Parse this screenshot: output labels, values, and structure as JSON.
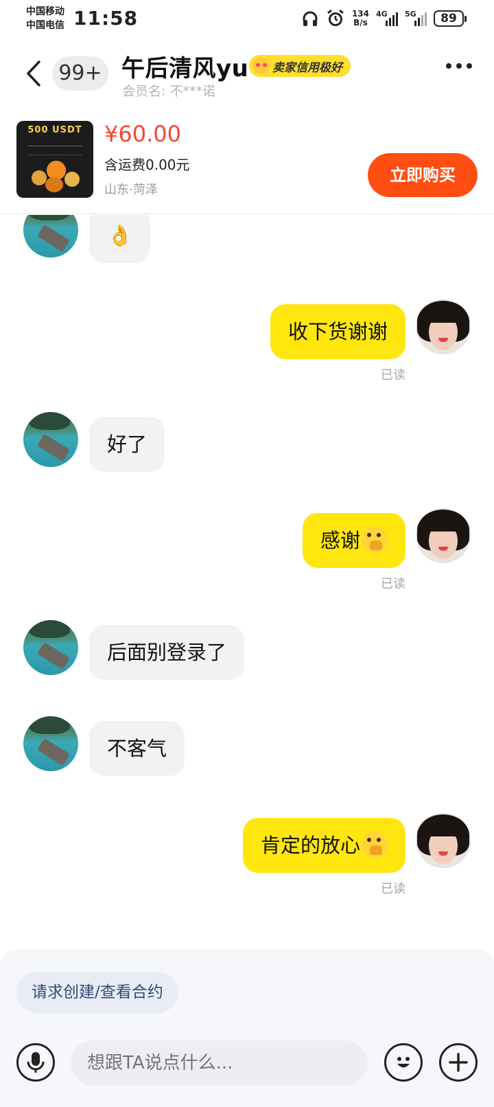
{
  "status_bar": {
    "carrier_1": "中国移动",
    "carrier_2": "中国电信",
    "time": "11:58",
    "speed_value": "134",
    "speed_unit": "B/s",
    "net_1": "4G",
    "net_2": "5G",
    "battery": "89"
  },
  "header": {
    "unread_count": "99+",
    "title": "午后清风yu",
    "credit_badge": "卖家信用极好",
    "member_label": "会员名: 不***诺"
  },
  "product": {
    "thumb_title": "500 USDT",
    "price": "¥60.00",
    "shipping": "含运费0.00元",
    "location": "山东·菏泽",
    "buy_label": "立即购买"
  },
  "messages": [
    {
      "side": "in",
      "text": "👌"
    },
    {
      "side": "out",
      "text": "收下货谢谢",
      "status": "已读"
    },
    {
      "side": "in",
      "text": "好了"
    },
    {
      "side": "out",
      "text": "感谢",
      "status": "已读"
    },
    {
      "side": "in",
      "text": "后面别登录了"
    },
    {
      "side": "in",
      "text": "不客气"
    },
    {
      "side": "out",
      "text": "肯定的放心",
      "status": "已读"
    }
  ],
  "composer": {
    "contract_label": "请求创建/查看合约",
    "input_placeholder": "想跟TA说点什么..."
  },
  "colors": {
    "price": "#f5472c",
    "buy_button": "#ff4e12",
    "outgoing_bubble": "#ffe60f",
    "incoming_bubble": "#f2f2f4",
    "credit_badge": "#ffdf2b"
  },
  "icons": {
    "back": "chevron-left-icon",
    "more": "more-dots-icon",
    "mic": "microphone-icon",
    "emoji": "smiley-icon",
    "plus": "plus-circle-icon"
  }
}
